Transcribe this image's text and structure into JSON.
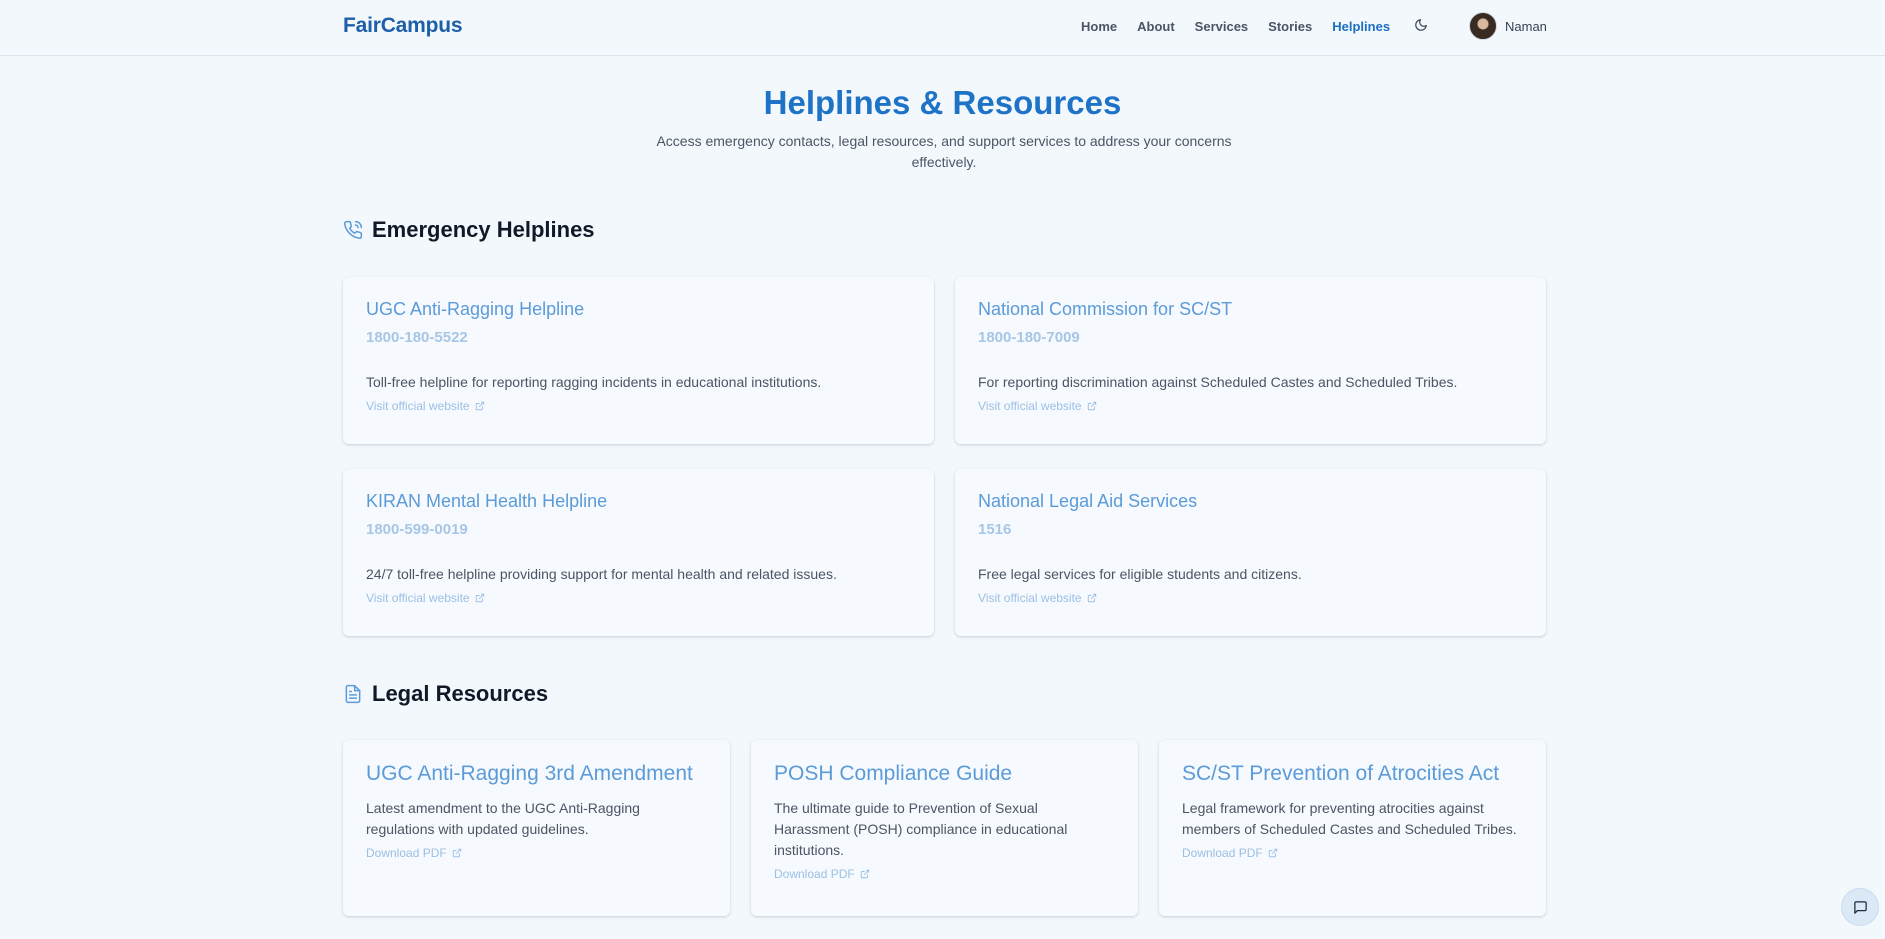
{
  "header": {
    "brand": "FairCampus",
    "nav": [
      {
        "label": "Home"
      },
      {
        "label": "About"
      },
      {
        "label": "Services"
      },
      {
        "label": "Stories"
      },
      {
        "label": "Helplines",
        "active": true
      }
    ],
    "theme_icon": "moon-icon",
    "user_name": "Naman"
  },
  "hero": {
    "title": "Helplines & Resources",
    "subtitle": "Access emergency contacts, legal resources, and support services to address your concerns effectively."
  },
  "emergency": {
    "title": "Emergency Helplines",
    "icon": "phone-icon",
    "cards": [
      {
        "title": "UGC Anti-Ragging Helpline",
        "phone": "1800-180-5522",
        "desc": "Toll-free helpline for reporting ragging incidents in educational institutions.",
        "link": "Visit official website"
      },
      {
        "title": "National Commission for SC/ST",
        "phone": "1800-180-7009",
        "desc": "For reporting discrimination against Scheduled Castes and Scheduled Tribes.",
        "link": "Visit official website"
      },
      {
        "title": "KIRAN Mental Health Helpline",
        "phone": "1800-599-0019",
        "desc": "24/7 toll-free helpline providing support for mental health and related issues.",
        "link": "Visit official website"
      },
      {
        "title": "National Legal Aid Services",
        "phone": "1516",
        "desc": "Free legal services for eligible students and citizens.",
        "link": "Visit official website"
      }
    ]
  },
  "legal": {
    "title": "Legal Resources",
    "icon": "document-icon",
    "cards": [
      {
        "title": "UGC Anti-Ragging 3rd Amendment",
        "desc": "Latest amendment to the UGC Anti-Ragging regulations with updated guidelines.",
        "link": "Download PDF"
      },
      {
        "title": "POSH Compliance Guide",
        "desc": "The ultimate guide to Prevention of Sexual Harassment (POSH) compliance in educational institutions.",
        "link": "Download PDF"
      },
      {
        "title": "SC/ST Prevention of Atrocities Act",
        "desc": "Legal framework for preventing atrocities against members of Scheduled Castes and Scheduled Tribes.",
        "link": "Download PDF"
      }
    ]
  },
  "chat_icon": "chat-icon",
  "colors": {
    "brand": "#1d5fa8",
    "title": "#1f73c7",
    "card_title": "#5b9bd8",
    "link": "#9cc0e4",
    "bg": "#f3f8fd"
  }
}
